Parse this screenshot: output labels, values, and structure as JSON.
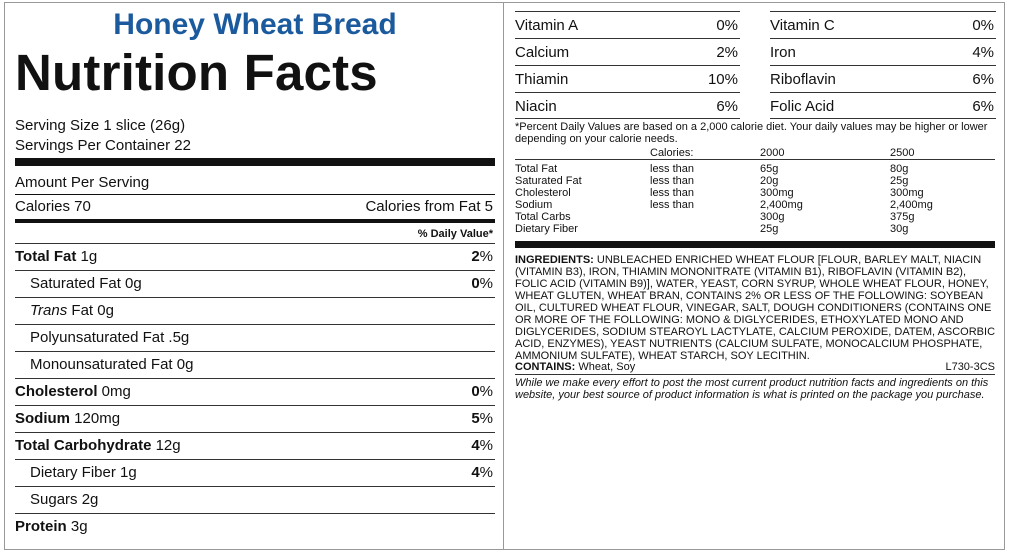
{
  "product_name": "Honey Wheat Bread",
  "title": "Nutrition Facts",
  "serving_size": "Serving Size 1 slice (26g)",
  "servings_per_container": "Servings Per Container 22",
  "amount_per_serving": "Amount Per Serving",
  "calories": "Calories 70",
  "calories_from_fat": "Calories from Fat 5",
  "daily_value_header": "% Daily Value*",
  "nutrients": [
    {
      "name": "Total Fat",
      "amount": " 1g",
      "pct": "2",
      "bold": true
    },
    {
      "name": "Saturated Fat",
      "amount": " 0g",
      "pct": "0",
      "bold": false
    },
    {
      "name": "Trans",
      "amount": " Fat 0g",
      "pct": "",
      "bold": false
    },
    {
      "name": "Polyunsaturated Fat",
      "amount": " .5g",
      "pct": "",
      "bold": false
    },
    {
      "name": "Monounsaturated Fat",
      "amount": " 0g",
      "pct": "",
      "bold": false
    },
    {
      "name": "Cholesterol",
      "amount": " 0mg",
      "pct": "0",
      "bold": true
    },
    {
      "name": "Sodium",
      "amount": " 120mg",
      "pct": "5",
      "bold": true
    },
    {
      "name": "Total Carbohydrate",
      "amount": " 12g",
      "pct": "4",
      "bold": true
    },
    {
      "name": "Dietary Fiber",
      "amount": " 1g",
      "pct": "4",
      "bold": false
    },
    {
      "name": "Sugars",
      "amount": " 2g",
      "pct": "",
      "bold": false
    },
    {
      "name": "Protein",
      "amount": " 3g",
      "pct": "",
      "bold": true
    }
  ],
  "pct_sign": "%",
  "vitamins": [
    {
      "name": "Vitamin A",
      "pct": "0%"
    },
    {
      "name": "Vitamin C",
      "pct": "0%"
    },
    {
      "name": "Calcium",
      "pct": "2%"
    },
    {
      "name": "Iron",
      "pct": "4%"
    },
    {
      "name": "Thiamin",
      "pct": "10%"
    },
    {
      "name": "Riboflavin",
      "pct": "6%"
    },
    {
      "name": "Niacin",
      "pct": "6%"
    },
    {
      "name": "Folic Acid",
      "pct": "6%"
    }
  ],
  "footnote": "*Percent Daily Values are based on a 2,000 calorie diet. Your daily values may be higher or lower depending on your calorie needs.",
  "dv_table": {
    "header": [
      "Calories:",
      "2000",
      "2500"
    ],
    "rows": [
      [
        "Total Fat",
        "less than",
        "65g",
        "80g"
      ],
      [
        "Saturated Fat",
        "less than",
        "20g",
        "25g"
      ],
      [
        "Cholesterol",
        "less than",
        "300mg",
        "300mg"
      ],
      [
        "Sodium",
        "less than",
        "2,400mg",
        "2,400mg"
      ],
      [
        "Total Carbs",
        "",
        "300g",
        "375g"
      ],
      [
        "Dietary Fiber",
        "",
        "25g",
        "30g"
      ]
    ]
  },
  "ingredients_label": "INGREDIENTS:",
  "ingredients_text": " UNBLEACHED ENRICHED WHEAT FLOUR [FLOUR, BARLEY MALT, NIACIN (VITAMIN B3), IRON, THIAMIN MONONITRATE (VITAMIN B1), RIBOFLAVIN (VITAMIN B2), FOLIC ACID (VITAMIN B9)], WATER, YEAST, CORN SYRUP, WHOLE WHEAT FLOUR, HONEY, WHEAT GLUTEN, WHEAT BRAN, CONTAINS 2% OR LESS OF THE FOLLOWING: SOYBEAN OIL, CULTURED WHEAT FLOUR, VINEGAR, SALT, DOUGH CONDITIONERS (CONTAINS ONE OR MORE OF THE FOLLOWING: MONO & DIGLYCERIDES, ETHOXYLATED MONO AND DIGLYCERIDES, SODIUM STEAROYL LACTYLATE, CALCIUM PEROXIDE, DATEM, ASCORBIC ACID, ENZYMES), YEAST NUTRIENTS (CALCIUM SULFATE, MONOCALCIUM PHOSPHATE, AMMONIUM SULFATE), WHEAT STARCH, SOY LECITHIN.",
  "contains_label": "CONTAINS:",
  "contains_text": " Wheat, Soy",
  "product_code": "L730-3CS",
  "disclaimer": "While we make every effort to post the most current product nutrition facts and ingredients on this website, your best source of product information is what is printed on the package you purchase."
}
